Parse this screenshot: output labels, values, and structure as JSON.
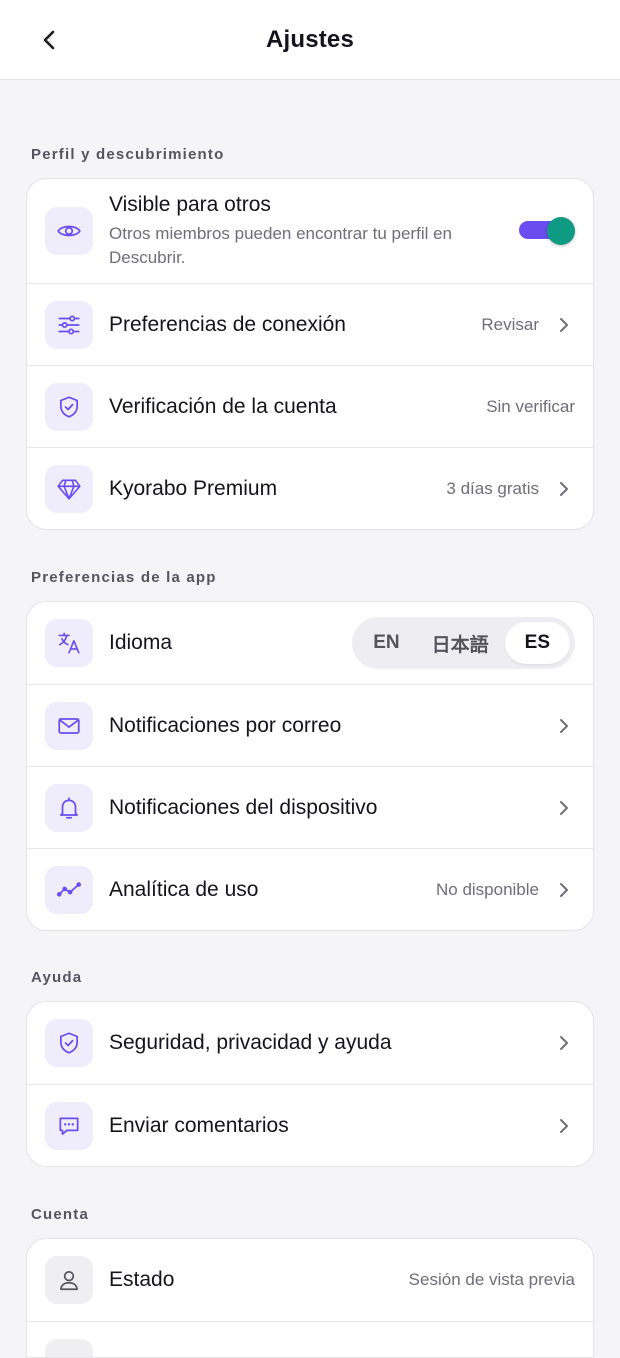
{
  "header": {
    "title": "Ajustes"
  },
  "sections": {
    "profile": {
      "title": "Perfil y descubrimiento",
      "visible": {
        "label": "Visible para otros",
        "sub": "Otros miembros pueden encontrar tu perfil en Descubrir.",
        "enabled": true
      },
      "connection": {
        "label": "Preferencias de conexión",
        "value": "Revisar"
      },
      "verification": {
        "label": "Verificación de la cuenta",
        "value": "Sin verificar"
      },
      "premium": {
        "label": "Kyorabo Premium",
        "value": "3 días gratis"
      }
    },
    "app": {
      "title": "Preferencias de la app",
      "language": {
        "label": "Idioma",
        "options": [
          "EN",
          "日本語",
          "ES"
        ],
        "selected": "ES"
      },
      "email": {
        "label": "Notificaciones por correo"
      },
      "device": {
        "label": "Notificaciones del dispositivo"
      },
      "analytics": {
        "label": "Analítica de uso",
        "value": "No disponible"
      }
    },
    "help": {
      "title": "Ayuda",
      "safety": {
        "label": "Seguridad, privacidad y ayuda"
      },
      "feedback": {
        "label": "Enviar comentarios"
      }
    },
    "account": {
      "title": "Cuenta",
      "status": {
        "label": "Estado",
        "value": "Sesión de vista previa"
      }
    }
  },
  "colors": {
    "accent": "#6a4df1",
    "toggle_knob": "#0f9a84",
    "icon_bg": "#efecfb"
  }
}
